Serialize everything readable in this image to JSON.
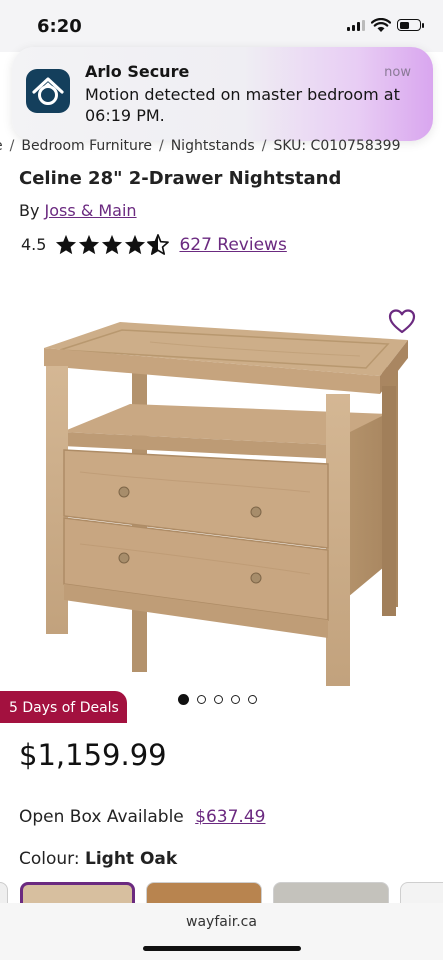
{
  "status": {
    "time": "6:20"
  },
  "notification": {
    "app": "Arlo Secure",
    "when": "now",
    "message": "Motion detected on master bedroom at 06:19 PM."
  },
  "breadcrumb": {
    "lead": "e",
    "items": [
      "Bedroom Furniture",
      "Nightstands"
    ],
    "sku": "SKU: C010758399"
  },
  "product": {
    "title": "Celine 28\" 2-Drawer Nightstand",
    "by": "By",
    "brand": "Joss & Main",
    "rating": "4.5",
    "rating_value": 4.5,
    "reviews": "627 Reviews",
    "badge": "5 Days of Deals",
    "price": "$1,159.99",
    "open_box_label": "Open Box Available",
    "open_box_price": "$637.49",
    "colour_label": "Colour:",
    "colour_value": "Light Oak",
    "image_index": 1,
    "image_count": 5
  },
  "browser": {
    "url": "wayfair.ca"
  },
  "colors": {
    "accent": "#6b2a80",
    "deal": "#a3113f",
    "wood": "#c9a985"
  }
}
